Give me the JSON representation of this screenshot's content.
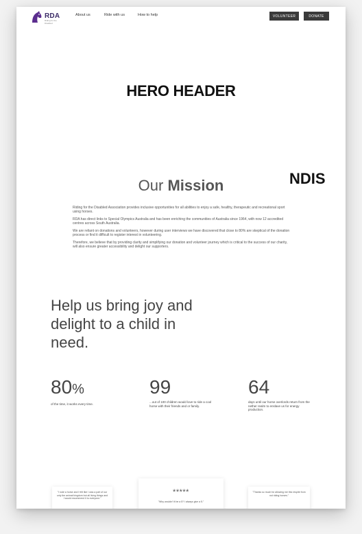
{
  "nav": {
    "logo_text": "RDA",
    "logo_subtext": "Riding for the Disabled",
    "links": [
      "About us",
      "Ride with us",
      "How to help"
    ],
    "volunteer_label": "VOLUNTEER",
    "donate_label": "DONATE"
  },
  "hero": {
    "title": "HERO HEADER"
  },
  "ndis": {
    "label": "NDIS"
  },
  "mission": {
    "title_light": "Our",
    "title_bold": "Mission",
    "paragraphs": [
      "Riding for the Disabled Association provides inclusive opportunities for all abilities to enjoy a safe, healthy, therapeutic and recreational sport using horses.",
      "RDA has direct links to Special Olympics Australia and has been enriching the communities of Australia since 1964, with now 12 accredited centres across South Australia.",
      "We are reliant on donations and volunteers, however during user interviews we have discovered that close to 80% are skeptical of the donation process or find it difficult to register interest in volunteering.",
      "Therefore, we believe that by providing clarity and simplifying our donation and volunteer journey which is critical to the success of our charity, will also ensure greater accessibility and delight our supporters."
    ]
  },
  "help": {
    "title": "Help us bring joy and delight to a child in need."
  },
  "stats": [
    {
      "number": "80",
      "unit": "%",
      "desc": "of the time, it works every time."
    },
    {
      "number": "99",
      "unit": "",
      "desc": "...out of 100 children would love to ride a cool horse with their friends and or family."
    },
    {
      "number": "64",
      "unit": "",
      "desc": "days until our horse overlords return from the nether realm to enslave us for energy production."
    }
  ],
  "testimonials": [
    {
      "quote": "\"I rode a horse and I felt like I was a part of our only the animal kingdom but all living things and I would recommend it to everyone.\""
    },
    {
      "stars": "*****",
      "quote": "\"Why wouldn't it be a 5? I always give a 5.\""
    },
    {
      "quote": "\"Thanks so much for allowing me this respite from not riding horses.\""
    }
  ]
}
